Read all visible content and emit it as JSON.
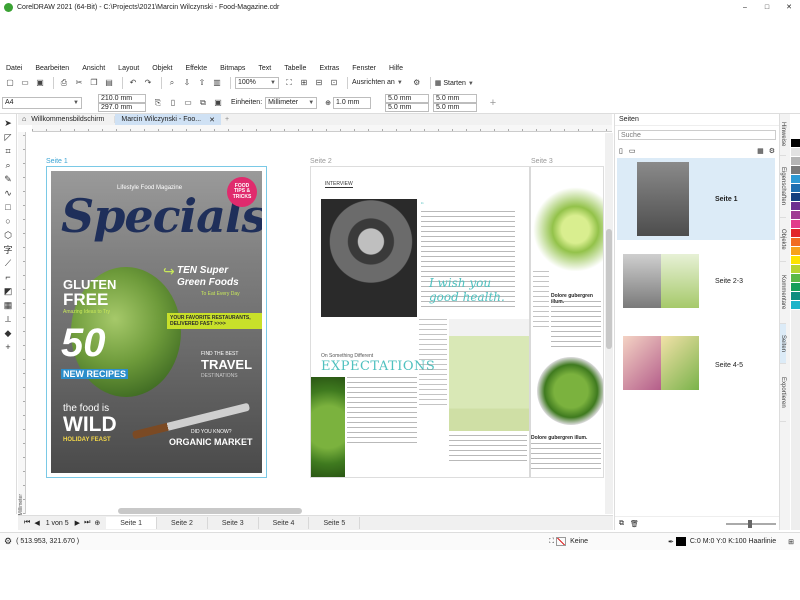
{
  "window": {
    "title": "CorelDRAW 2021 (64-Bit) - C:\\Projects\\2021\\Marcin Wilczynski - Food-Magazine.cdr",
    "min": "–",
    "max": "□",
    "close": "✕"
  },
  "menu": [
    "Datei",
    "Bearbeiten",
    "Ansicht",
    "Layout",
    "Objekt",
    "Effekte",
    "Bitmaps",
    "Text",
    "Tabelle",
    "Extras",
    "Fenster",
    "Hilfe"
  ],
  "toolbar": {
    "zoom": "100%",
    "snap_label": "Ausrichten an",
    "start_label": "Starten"
  },
  "property_bar": {
    "page_size": "A4",
    "width": "210.0 mm",
    "height": "297.0 mm",
    "units_label": "Einheiten:",
    "units": "Millimeter",
    "nudge": "1.0 mm",
    "dup_x": "5.0 mm",
    "dup_y": "5.0 mm",
    "dup_x2": "5.0 mm",
    "dup_y2": "5.0 mm"
  },
  "doc_tabs": [
    {
      "label": "Willkommensbildschirm"
    },
    {
      "label": "Marcin Wilczynski - Foo..."
    }
  ],
  "canvas": {
    "page_labels": [
      "Seite 1",
      "Seite 2",
      "Seite 3"
    ],
    "ruler_label": "Millimeter",
    "cover": {
      "brand": "Lifestyle Food Magazine",
      "title": "Specials",
      "badge": "FOOD TIPS & TRICKS",
      "gluten1": "GLUTEN",
      "gluten2": "FREE",
      "gluten_sub": "Amazing Ideas to Try",
      "green1": "TEN Super",
      "green2": "Green Foods",
      "green_sub": "To Eat Every Day",
      "banner": "YOUR FAVORITE RESTAURANTS, DELIVERED FAST >>>>",
      "fifty": "50",
      "recipes": "NEW RECIPES",
      "travel_sm": "FIND THE BEST",
      "travel": "TRAVEL",
      "travel_sub": "DESTINATIONS",
      "wild_sm": "the food is",
      "wild": "WILD",
      "holiday": "HOLIDAY FEAST",
      "market_sm": "DID YOU KNOW?",
      "market": "ORGANIC MARKET"
    },
    "spread": {
      "interview": "INTERVIEW",
      "kicker": "On Something Different",
      "headline": "EXPECTATIONS",
      "quote": "I wish you good health.",
      "sidebar_title": "Dolore gubergren illum.",
      "sidebar_title2": "Dolore gubergren illum."
    }
  },
  "page_nav": {
    "counter": "1 von 5",
    "tabs": [
      "Seite 1",
      "Seite 2",
      "Seite 3",
      "Seite 4",
      "Seite 5"
    ]
  },
  "docker": {
    "title": "Seiten",
    "search_placeholder": "Suche",
    "pages": [
      "Seite 1",
      "Seite 2-3",
      "Seite 4-5"
    ],
    "vertical_tabs": [
      "Hinweise",
      "Eigenschaften",
      "Objekte",
      "Kommentare",
      "Seiten",
      "Exportieren"
    ]
  },
  "status": {
    "coords": "( 513.953, 321.670 )",
    "fill": "Keine",
    "outline": "C:0 M:0 Y:0 K:100 Haarlinie"
  },
  "palette": [
    "#ffffff",
    "#000000",
    "#e2e2e2",
    "#b5b5b5",
    "#7a7a7a",
    "#2e9ad4",
    "#1d6fb0",
    "#13407f",
    "#6d2f91",
    "#a03c94",
    "#e23c8c",
    "#e2262a",
    "#f16c21",
    "#f7a21b",
    "#fee300",
    "#b8d431",
    "#5bb948",
    "#16a05b",
    "#0f8e80",
    "#1db4c9"
  ]
}
